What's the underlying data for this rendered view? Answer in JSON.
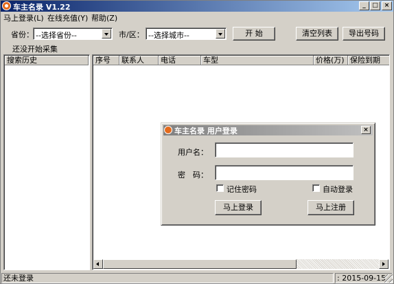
{
  "window": {
    "title": "车主名录 V1.22"
  },
  "title_buttons": {
    "minimize": "_",
    "maximize": "□",
    "close": "×"
  },
  "menu": [
    {
      "label": "马上登录(L)"
    },
    {
      "label": "在线充值(Y)"
    },
    {
      "label": "帮助(Z)"
    }
  ],
  "filters": {
    "province_label": "省份：",
    "province_value": "--选择省份--",
    "city_label": "市/区：",
    "city_value": "--选择城市--",
    "start_button": "开 始",
    "clear_button": "清空列表",
    "export_button": "导出号码",
    "status_text": "还没开始采集"
  },
  "history": {
    "header": "搜索历史"
  },
  "table": {
    "columns": [
      "序号",
      "联系人",
      "电话",
      "车型",
      "价格(万)",
      "保险到期"
    ]
  },
  "login_dialog": {
    "title": "车主名录 用户登录",
    "close": "×",
    "username_label": "用户名：",
    "username_value": "",
    "password_label": "密　码：",
    "password_value": "",
    "remember_label": "记住密码",
    "autologin_label": "自动登录",
    "login_button": "马上登录",
    "register_button": "马上注册"
  },
  "statusbar": {
    "login_status": "还未登录",
    "date": ": 2015-09-15"
  },
  "colors": {
    "title_active": "#0a246a",
    "title_inactive": "#808080",
    "face": "#d4d0c8",
    "icon": "#e46a1c"
  },
  "icons": [
    "app-icon",
    "minimize-icon",
    "maximize-icon",
    "close-icon",
    "dropdown-arrow-icon",
    "scroll-left-icon",
    "scroll-right-icon",
    "resize-grip-icon"
  ]
}
